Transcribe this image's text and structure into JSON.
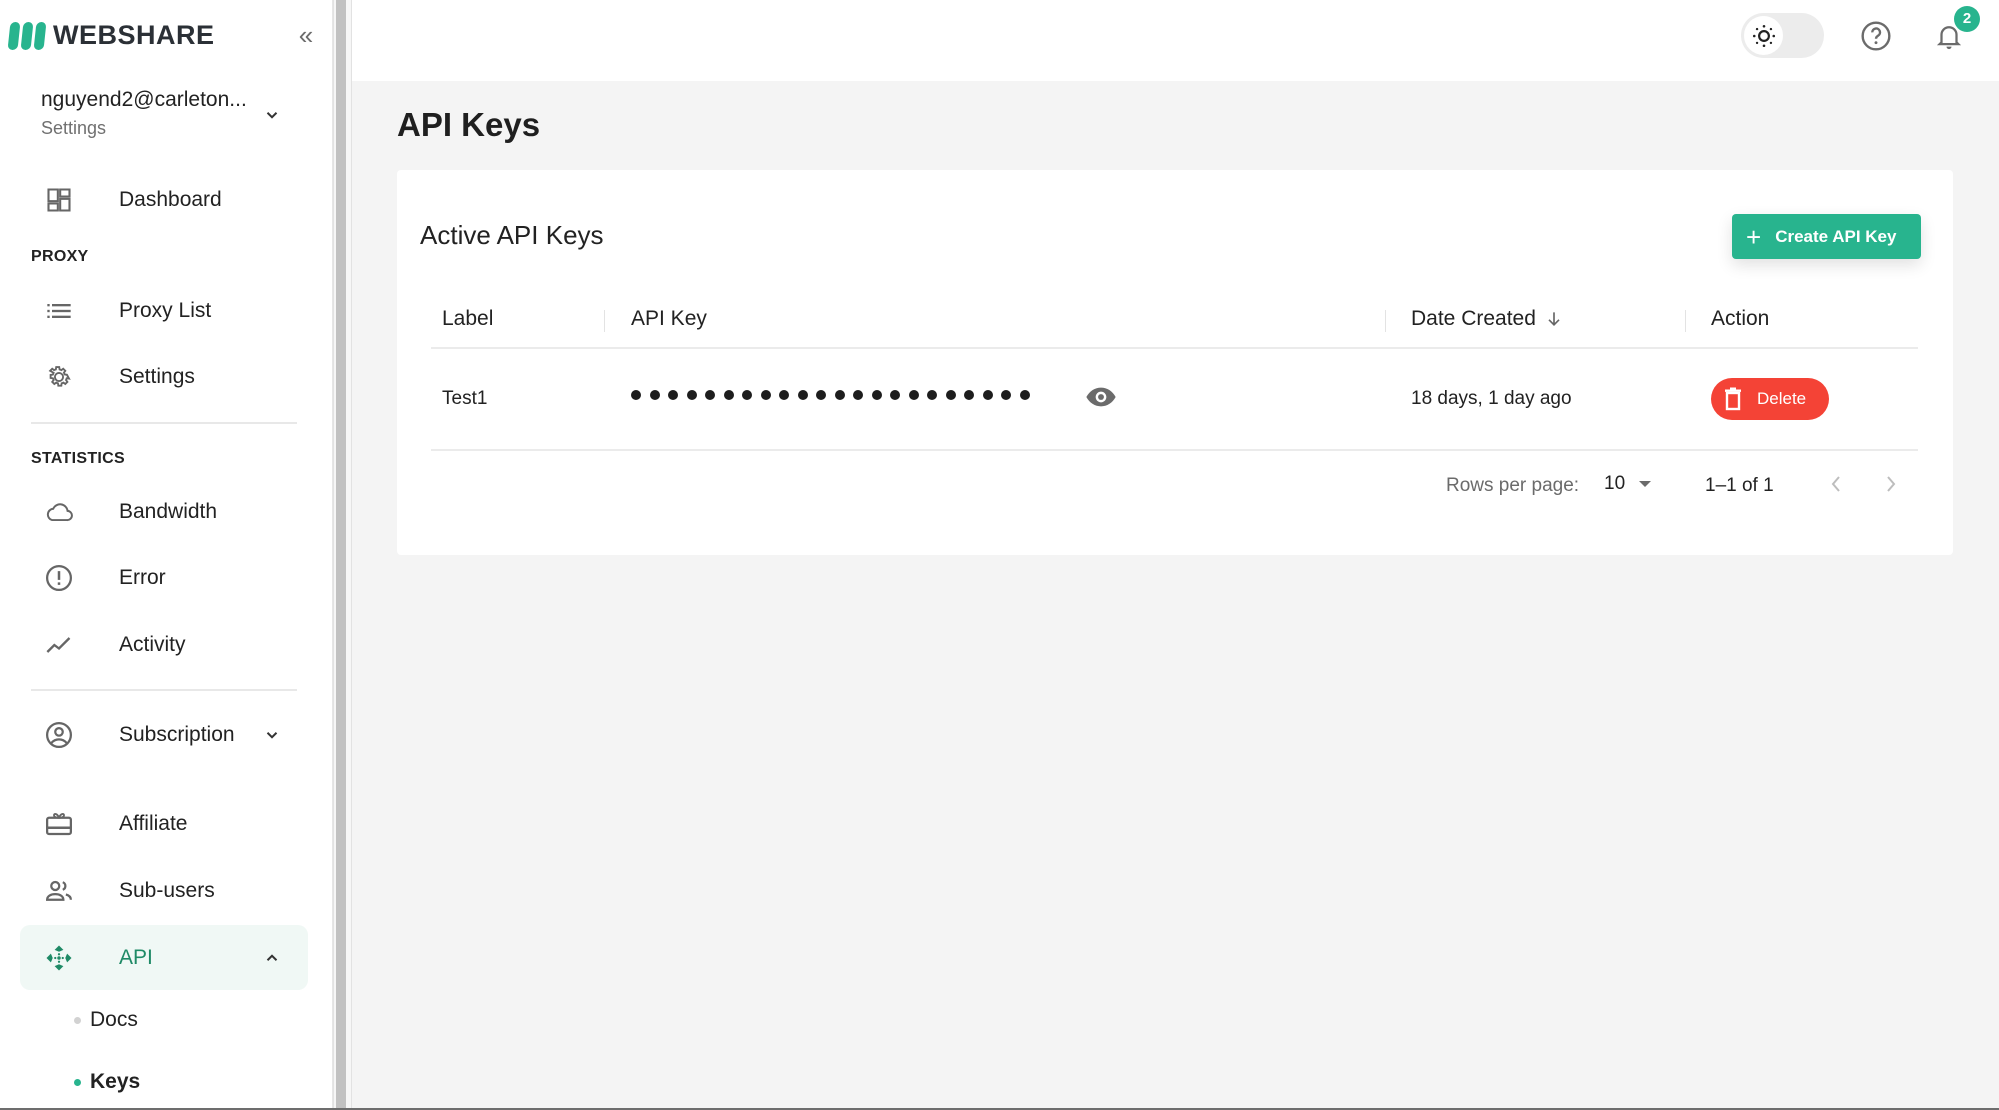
{
  "brand": {
    "name": "WEBSHARE",
    "color": "#28b48e"
  },
  "sidebar": {
    "collapse_glyph": "«",
    "account": {
      "email": "nguyend2@carleton...",
      "subtitle": "Settings"
    },
    "dashboard": {
      "label": "Dashboard",
      "icon": "dashboard-icon"
    },
    "sections": {
      "proxy": "PROXY",
      "statistics": "STATISTICS"
    },
    "items": [
      {
        "label": "Proxy List",
        "icon": "list-icon"
      },
      {
        "label": "Settings",
        "icon": "gear-icon"
      },
      {
        "label": "Bandwidth",
        "icon": "cloud-icon"
      },
      {
        "label": "Error",
        "icon": "error-icon"
      },
      {
        "label": "Activity",
        "icon": "trending-icon"
      },
      {
        "label": "Subscription",
        "icon": "account-circle-icon"
      },
      {
        "label": "Affiliate",
        "icon": "gift-card-icon"
      },
      {
        "label": "Sub-users",
        "icon": "people-icon"
      },
      {
        "label": "API",
        "icon": "api-icon",
        "active": true
      }
    ],
    "api_subitems": [
      {
        "label": "Docs",
        "active": false
      },
      {
        "label": "Keys",
        "active": true
      }
    ]
  },
  "topbar": {
    "theme": "light",
    "notifications_count": "2"
  },
  "page": {
    "title": "API Keys",
    "card_title": "Active API Keys",
    "create_button": "Create API Key",
    "table": {
      "columns": [
        "Label",
        "API Key",
        "Date Created",
        "Action"
      ],
      "sort_column": "Date Created",
      "sort_direction": "descending",
      "rows": [
        {
          "label": "Test1",
          "api_key_masked": "••••••••••••••••••••••",
          "mask_length": 22,
          "date_created": "18 days, 1 day ago",
          "action": "Delete"
        }
      ]
    },
    "pagination": {
      "rows_per_page_label": "Rows per page:",
      "rows_per_page": "10",
      "range": "1–1 of 1"
    }
  },
  "colors": {
    "accent": "#28b48e",
    "accent_dark": "#1f8a66",
    "danger": "#f44336",
    "background": "#f4f4f4"
  }
}
